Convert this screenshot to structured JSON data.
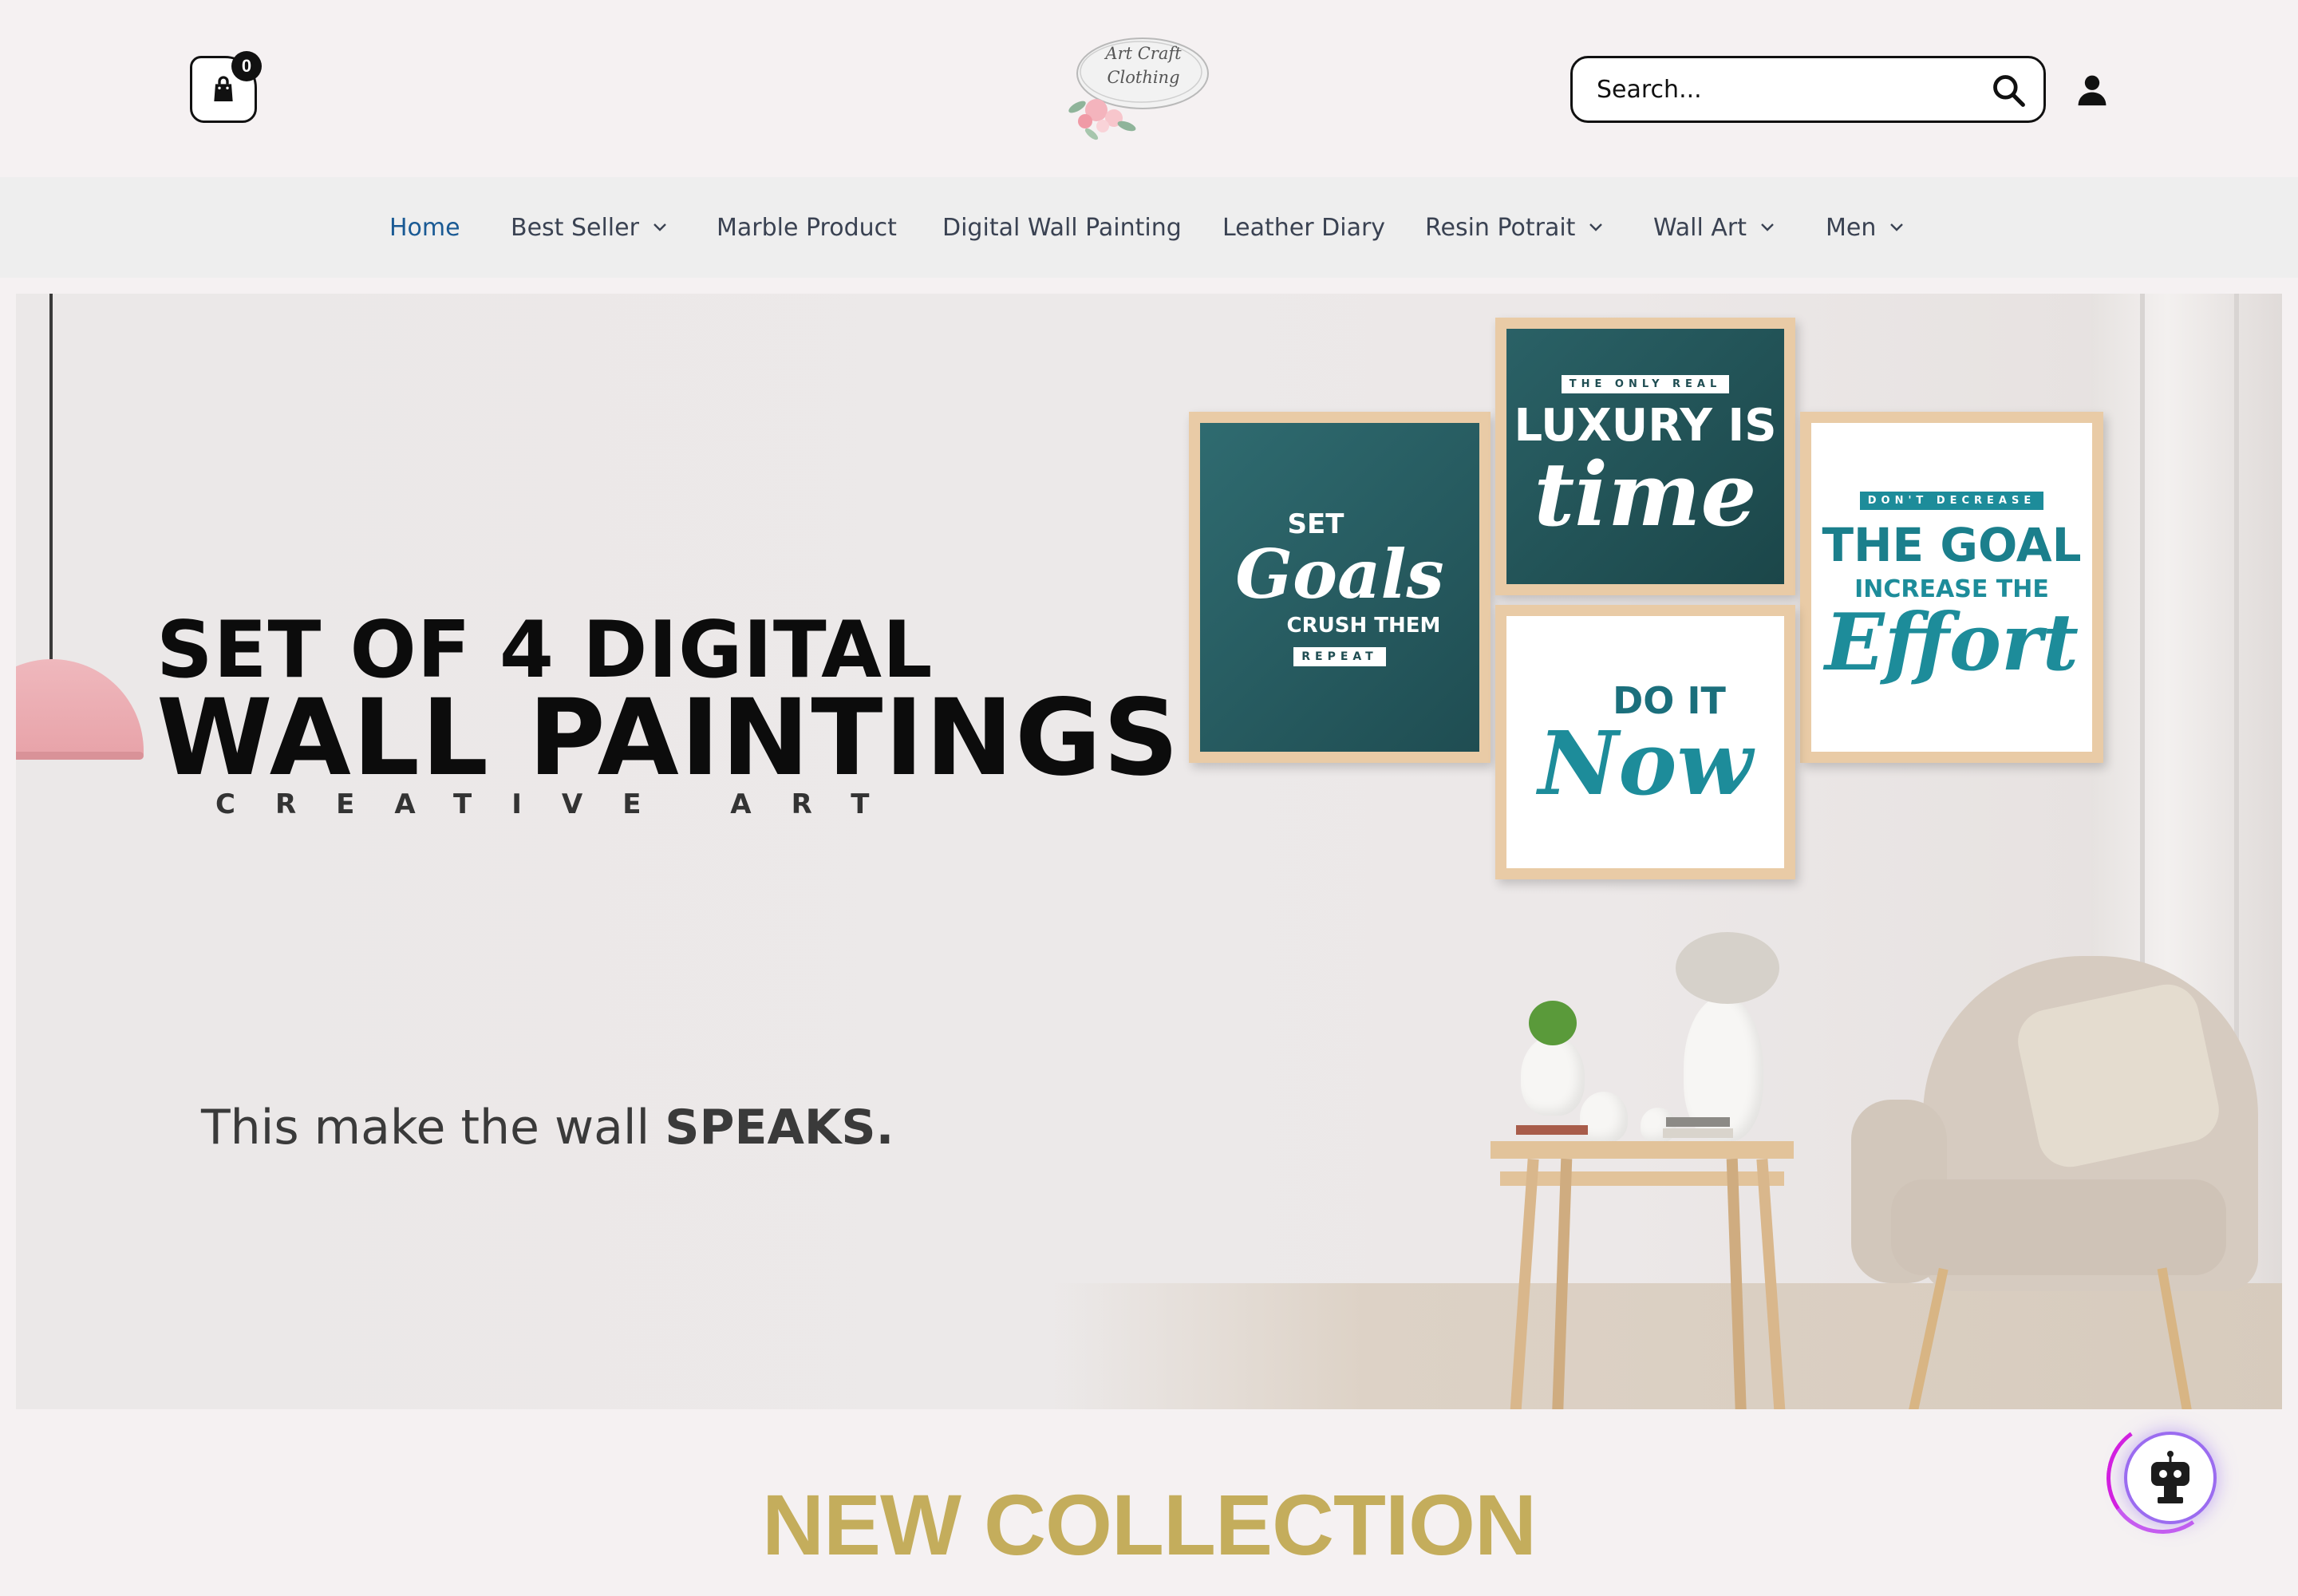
{
  "header": {
    "cart_count": "0",
    "logo_line1": "Art Craft",
    "logo_line2": "Clothing",
    "search_placeholder": "Search..."
  },
  "nav": {
    "items": [
      {
        "label": "Home",
        "active": true,
        "has_dropdown": false
      },
      {
        "label": "Best Seller",
        "active": false,
        "has_dropdown": true
      },
      {
        "label": "Marble Product",
        "active": false,
        "has_dropdown": false
      },
      {
        "label": "Digital Wall Painting",
        "active": false,
        "has_dropdown": false
      },
      {
        "label": "Leather Diary",
        "active": false,
        "has_dropdown": false
      },
      {
        "label": "Resin Potrait",
        "active": false,
        "has_dropdown": true
      },
      {
        "label": "Wall Art",
        "active": false,
        "has_dropdown": true
      },
      {
        "label": "Men",
        "active": false,
        "has_dropdown": true
      }
    ]
  },
  "hero": {
    "line1": "SET OF 4 DIGITAL",
    "line2": "WALL PAINTINGS",
    "line3": "CREATIVE ART",
    "tagline_plain": "This make the wall ",
    "tagline_bold": "SPEAKS.",
    "frames": {
      "goals": {
        "top": "SET",
        "script": "Goals",
        "mid": "CRUSH THEM",
        "bottom": "REPEAT"
      },
      "luxury": {
        "top": "THE ONLY REAL",
        "big": "LUXURY IS",
        "script": "time"
      },
      "goal": {
        "top": "DON'T DECREASE",
        "big": "THE GOAL",
        "mid": "INCREASE THE",
        "script": "Effort"
      },
      "now": {
        "big": "DO IT",
        "script": "Now"
      }
    }
  },
  "collection": {
    "title": "NEW COLLECTION"
  },
  "colors": {
    "background": "#f5f1f2",
    "nav_background": "#eeeeee",
    "nav_active": "#1a5a94",
    "nav_text": "#3a4252",
    "collection_title": "#c4ad5c",
    "frame_teal": "#2f6b70",
    "frame_text_teal": "#1d8c9a"
  },
  "icons": {
    "cart": "shopping-bag-icon",
    "search": "search-icon",
    "user": "user-icon",
    "dropdown": "chevron-down-icon",
    "chatbot": "chatbot-icon"
  }
}
